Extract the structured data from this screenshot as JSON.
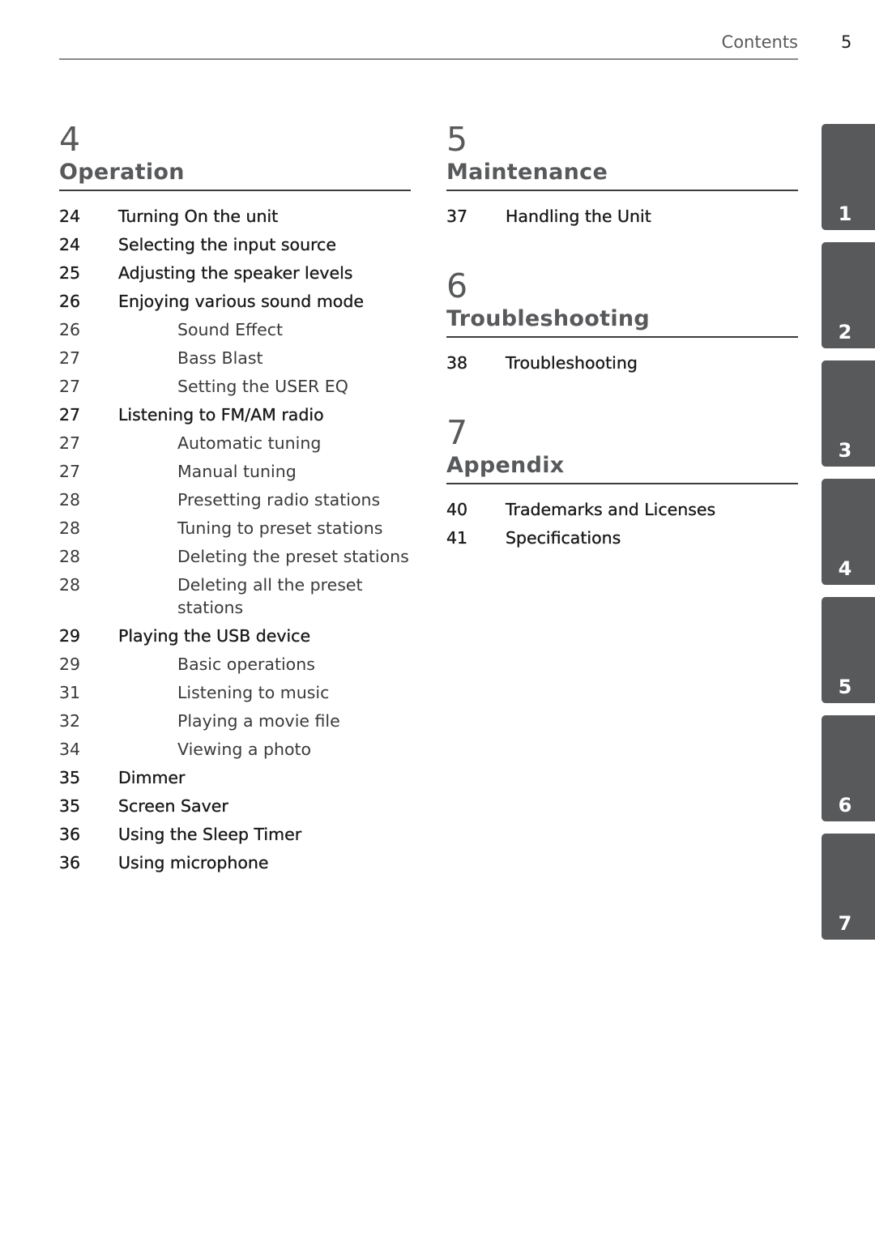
{
  "header": {
    "title": "Contents",
    "page_number": "5"
  },
  "chapters_left": [
    {
      "number": "4",
      "title": "Operation",
      "entries": [
        {
          "page": "24",
          "text": "Turning On the unit",
          "level": "main"
        },
        {
          "page": "24",
          "text": "Selecting the input source",
          "level": "main"
        },
        {
          "page": "25",
          "text": "Adjusting the speaker levels",
          "level": "main"
        },
        {
          "page": "26",
          "text": "Enjoying various sound mode",
          "level": "main"
        },
        {
          "page": "26",
          "text": "Sound Effect",
          "level": "sub"
        },
        {
          "page": "27",
          "text": "Bass Blast",
          "level": "sub"
        },
        {
          "page": "27",
          "text": "Setting the USER EQ",
          "level": "sub"
        },
        {
          "page": "27",
          "text": "Listening to FM/AM radio",
          "level": "main"
        },
        {
          "page": "27",
          "text": "Automatic tuning",
          "level": "sub"
        },
        {
          "page": "27",
          "text": "Manual tuning",
          "level": "sub"
        },
        {
          "page": "28",
          "text": "Presetting radio stations",
          "level": "sub"
        },
        {
          "page": "28",
          "text": "Tuning to preset stations",
          "level": "sub"
        },
        {
          "page": "28",
          "text": "Deleting the preset stations",
          "level": "sub"
        },
        {
          "page": "28",
          "text": "Deleting all the preset stations",
          "level": "sub"
        },
        {
          "page": "29",
          "text": "Playing the USB device",
          "level": "main"
        },
        {
          "page": "29",
          "text": "Basic operations",
          "level": "sub"
        },
        {
          "page": "31",
          "text": "Listening to music",
          "level": "sub"
        },
        {
          "page": "32",
          "text": "Playing a movie file",
          "level": "sub"
        },
        {
          "page": "34",
          "text": "Viewing a photo",
          "level": "sub"
        },
        {
          "page": "35",
          "text": "Dimmer",
          "level": "main"
        },
        {
          "page": "35",
          "text": "Screen Saver",
          "level": "main"
        },
        {
          "page": "36",
          "text": "Using the Sleep Timer",
          "level": "main"
        },
        {
          "page": "36",
          "text": "Using microphone",
          "level": "main"
        }
      ]
    }
  ],
  "chapters_right": [
    {
      "number": "5",
      "title": "Maintenance",
      "entries": [
        {
          "page": "37",
          "text": "Handling the Unit",
          "level": "main"
        }
      ]
    },
    {
      "number": "6",
      "title": "Troubleshooting",
      "entries": [
        {
          "page": "38",
          "text": "Troubleshooting",
          "level": "main"
        }
      ]
    },
    {
      "number": "7",
      "title": "Appendix",
      "entries": [
        {
          "page": "40",
          "text": "Trademarks and Licenses",
          "level": "main"
        },
        {
          "page": "41",
          "text": "Specifications",
          "level": "main"
        }
      ]
    }
  ],
  "side_tabs": [
    "1",
    "2",
    "3",
    "4",
    "5",
    "6",
    "7"
  ],
  "colors": {
    "tab_bg": "#58595b",
    "heading": "#58595b",
    "text": "#231f20"
  }
}
